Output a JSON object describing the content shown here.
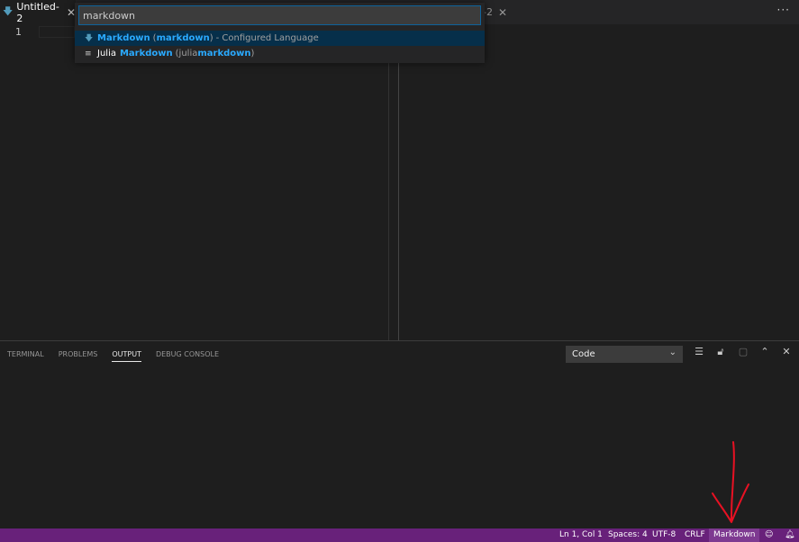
{
  "tabs": {
    "left_title": "Untitled-2",
    "right_title_fragment": "-2",
    "close_glyph": "✕",
    "more_actions": "···"
  },
  "editor": {
    "line_numbers": [
      "1"
    ]
  },
  "quick_pick": {
    "input_value": "markdown",
    "items": [
      {
        "icon": "markdown-file-icon",
        "label_highlight": "Markdown",
        "id_open": "(",
        "id_highlight": "markdown",
        "id_close": ")",
        "description": "- Configured Language"
      },
      {
        "icon": "text-lines-icon",
        "label_prefix": "Julia",
        "label_highlight": "Markdown",
        "id_open": "(julia",
        "id_highlight": "markdown",
        "id_close": ")"
      }
    ]
  },
  "panel": {
    "tabs": [
      "TERMINAL",
      "PROBLEMS",
      "OUTPUT",
      "DEBUG CONSOLE"
    ],
    "active_tab": "OUTPUT",
    "channel_selected": "Code"
  },
  "status_bar": {
    "cursor_position": "Ln 1, Col 1",
    "indentation": "Spaces: 4",
    "encoding": "UTF-8",
    "line_ending": "CRLF",
    "language_mode": "Markdown",
    "background_color": "#68217a"
  },
  "annotation": {
    "type": "hand-drawn arrow pointing down",
    "color": "#e81123"
  }
}
